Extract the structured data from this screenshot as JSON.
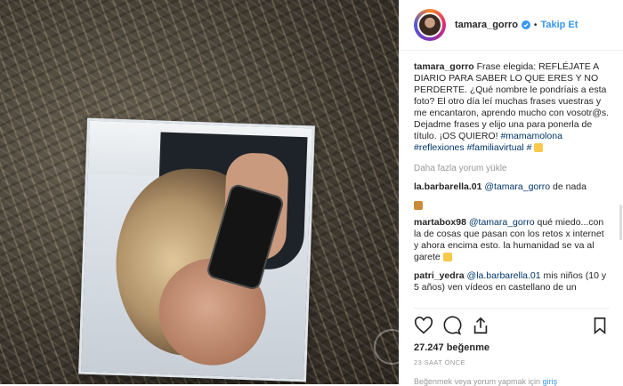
{
  "post": {
    "username": "tamara_gorro",
    "follow_label": "Takip Et",
    "separator": "•",
    "caption_username": "tamara_gorro",
    "caption_text": "Frase elegida: REFLÉJATE A DIARIO PARA SABER LO QUE ERES Y NO PERDERTE. ¿Qué nombre le pondríais a esta foto? El otro día leí muchas frases vuestras y me encantaron, aprendo mucho con vosotr@s. Dejadme frases y elijo una para ponerla de título. ¡OS QUIERO!",
    "hashtags": "#mamamolona #reflexiones #familiavirtual",
    "hashtag_tail": "#",
    "load_more": "Daha fazla yorum yükle",
    "comments": [
      {
        "user": "la.barbarella.01",
        "mention": "@tamara_gorro",
        "text": "de nada"
      },
      {
        "user": "martabox98",
        "mention": "@tamara_gorro",
        "text": "qué miedo...con la de cosas que pasan con los retos x internet y ahora encima esto. la humanidad se va al garete"
      },
      {
        "user": "patri_yedra",
        "mention": "@la.barbarella.01",
        "text": "mis niños (10 y 5 años) ven vídeos en castellano de un"
      }
    ],
    "likes": "27.247 beğenme",
    "timestamp": "23 SAAT ÖNCE",
    "footer_text": "Beğenmek veya yorum yapmak için",
    "footer_link": "giriş"
  },
  "icons": {
    "verified": "verified-badge-icon",
    "like": "heart-icon",
    "comment": "comment-bubble-icon",
    "share": "share-icon",
    "save": "bookmark-icon"
  },
  "colors": {
    "accent": "#3897f0",
    "text": "#262626",
    "muted": "#999999",
    "link": "#003569",
    "border": "#efefef"
  }
}
